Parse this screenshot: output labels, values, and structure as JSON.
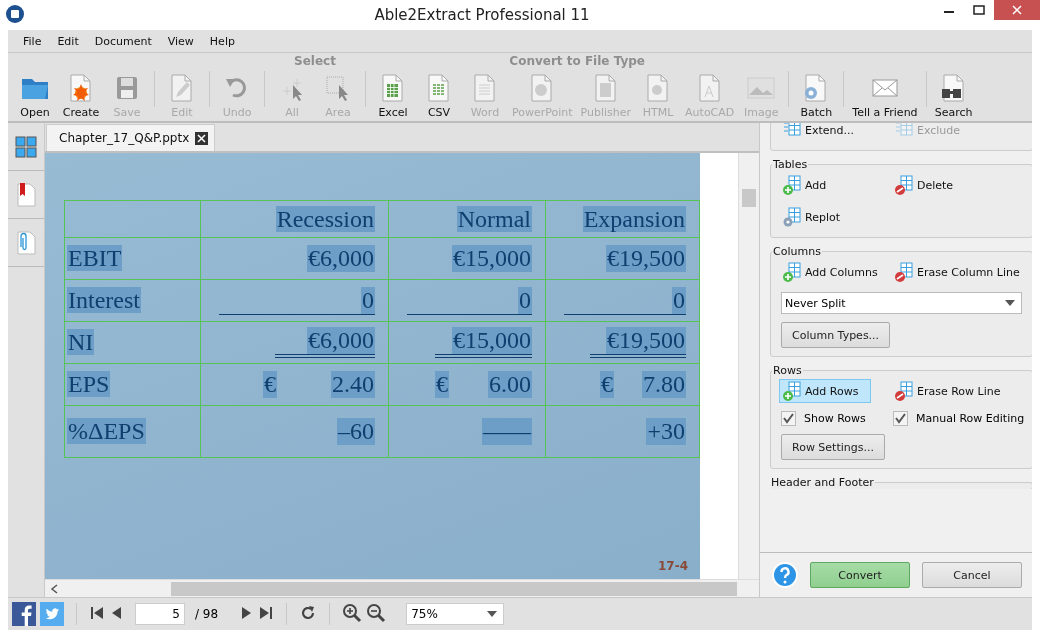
{
  "window": {
    "title": "Able2Extract Professional 11"
  },
  "menu": [
    "File",
    "Edit",
    "Document",
    "View",
    "Help"
  ],
  "toolbar": [
    {
      "buttons": [
        {
          "label": "Open",
          "disabled": false
        },
        {
          "label": "Create",
          "disabled": false
        },
        {
          "label": "Save",
          "disabled": true
        }
      ]
    },
    {
      "buttons": [
        {
          "label": "Edit",
          "disabled": true
        }
      ]
    },
    {
      "buttons": [
        {
          "label": "Undo",
          "disabled": true
        }
      ]
    },
    {
      "heading": "Select",
      "buttons": [
        {
          "label": "All",
          "disabled": true
        },
        {
          "label": "Area",
          "disabled": true
        }
      ]
    },
    {
      "heading": "Convert to File Type",
      "buttons": [
        {
          "label": "Excel",
          "disabled": false
        },
        {
          "label": "CSV",
          "disabled": false
        },
        {
          "label": "Word",
          "disabled": true
        },
        {
          "label": "PowerPoint",
          "disabled": true
        },
        {
          "label": "Publisher",
          "disabled": true
        },
        {
          "label": "HTML",
          "disabled": true
        },
        {
          "label": "AutoCAD",
          "disabled": true
        },
        {
          "label": "Image",
          "disabled": true
        }
      ]
    },
    {
      "buttons": [
        {
          "label": "Batch",
          "disabled": false
        }
      ]
    },
    {
      "buttons": [
        {
          "label": "Tell a Friend",
          "disabled": false
        }
      ]
    },
    {
      "buttons": [
        {
          "label": "Search",
          "disabled": false
        }
      ]
    }
  ],
  "document": {
    "tab": "Chapter_17_Q&P.pptx",
    "slide_number": "17-4",
    "table": {
      "header": [
        "Recession",
        "Normal",
        "Expansion"
      ],
      "rows": [
        {
          "label": "EBIT",
          "underlined": false,
          "double_underlined": false,
          "cells": [
            {
              "amount": "€6,000"
            },
            {
              "amount": "€15,000"
            },
            {
              "amount": "€19,500"
            }
          ]
        },
        {
          "label": "Interest",
          "underlined": true,
          "double_underlined": false,
          "cells": [
            {
              "amount": "0"
            },
            {
              "amount": "0"
            },
            {
              "amount": "0"
            }
          ]
        },
        {
          "label": "NI",
          "underlined": false,
          "double_underlined": true,
          "cells": [
            {
              "amount": "€6,000"
            },
            {
              "amount": "€15,000"
            },
            {
              "amount": "€19,500"
            }
          ]
        },
        {
          "label": "EPS",
          "underlined": false,
          "double_underlined": false,
          "cells": [
            {
              "currency": "€",
              "amount": "2.40"
            },
            {
              "currency": "€",
              "amount": "6.00"
            },
            {
              "currency": "€",
              "amount": "7.80"
            }
          ]
        },
        {
          "label": "%ΔEPS",
          "underlined": false,
          "double_underlined": false,
          "cells": [
            {
              "amount": "–60"
            },
            {
              "amount": "——"
            },
            {
              "amount": "+30"
            }
          ]
        }
      ]
    }
  },
  "panel": {
    "sections": [
      {
        "items": [
          {
            "kind": "action",
            "label": "Extend...",
            "disabled": false,
            "selected": false
          },
          {
            "kind": "action",
            "label": "Exclude",
            "disabled": true,
            "selected": false
          }
        ]
      },
      {
        "title": "Tables",
        "items": [
          {
            "kind": "action",
            "label": "Add",
            "disabled": false,
            "selected": false
          },
          {
            "kind": "action",
            "label": "Delete",
            "disabled": false,
            "selected": false
          },
          {
            "kind": "action",
            "label": "Replot",
            "disabled": false,
            "selected": false
          }
        ]
      },
      {
        "title": "Columns",
        "items": [
          {
            "kind": "action",
            "label": "Add Columns",
            "disabled": false,
            "selected": false
          },
          {
            "kind": "action",
            "label": "Erase Column Line",
            "disabled": false,
            "selected": false
          },
          {
            "kind": "select",
            "value": "Never Split"
          },
          {
            "kind": "button",
            "label": "Column Types..."
          }
        ]
      },
      {
        "title": "Rows",
        "items": [
          {
            "kind": "action",
            "label": "Add Rows",
            "disabled": false,
            "selected": true
          },
          {
            "kind": "action",
            "label": "Erase Row Line",
            "disabled": false,
            "selected": false
          },
          {
            "kind": "checkbox",
            "label": "Show Rows",
            "checked": true
          },
          {
            "kind": "checkbox",
            "label": "Manual Row Editing",
            "checked": true
          },
          {
            "kind": "button",
            "label": "Row Settings..."
          }
        ]
      },
      {
        "title": "Header and Footer"
      }
    ],
    "buttons": [
      "Convert",
      "Cancel"
    ]
  },
  "status_bar": {
    "page": "5",
    "page_count": "/ 98",
    "zoom": "75%"
  }
}
